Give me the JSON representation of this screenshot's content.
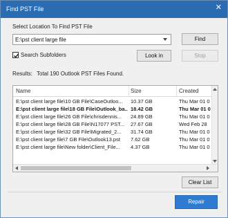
{
  "window": {
    "title": "Find PST File",
    "close_glyph": "✕"
  },
  "location": {
    "label": "Select Location To Find PST File",
    "value": "E:\\pst client large file"
  },
  "buttons": {
    "find": "Find",
    "look_in": "Look in",
    "stop": "Stop",
    "clear_list": "Clear List",
    "repair": "Repair"
  },
  "search_subfolders": {
    "label": "Search Subfolders",
    "checked": true
  },
  "results": {
    "label": "Results:",
    "summary": "Total 190 Outlook PST Files Found."
  },
  "table": {
    "columns": [
      "Name",
      "Size",
      "Created"
    ],
    "rows": [
      {
        "name": "E:\\pst client large file\\10 GB File\\CaseOutloo...",
        "size": "10.37 GB",
        "created": "Thu Mar 01 0"
      },
      {
        "name": "E:\\pst client large file\\18 GB File\\Outlook_ba...",
        "size": "18.42 GB",
        "created": "Thu Mar 01 0"
      },
      {
        "name": "E:\\pst client large file\\26 GB File\\chrisdennis...",
        "size": "24.89 GB",
        "created": "Thu Mar 01 0"
      },
      {
        "name": "E:\\pst client large file\\28 GB File\\N17077 PST...",
        "size": "27.67 GB",
        "created": "Wed Feb 28"
      },
      {
        "name": "E:\\pst client large file\\32 GB File\\Migrated_2...",
        "size": "31.74 GB",
        "created": "Thu Mar 01 0"
      },
      {
        "name": "E:\\pst client large file\\7 GB File\\Outlook13.pst",
        "size": "7.62 GB",
        "created": "Thu Mar 01 0"
      },
      {
        "name": "E:\\pst client large file\\New folder\\Client_File...",
        "size": "4.37 GB",
        "created": "Thu Mar 01 0"
      }
    ],
    "selected_row": 1
  },
  "colors": {
    "titlebar": "#2b6cb3",
    "primary_button": "#2e7bd1"
  }
}
